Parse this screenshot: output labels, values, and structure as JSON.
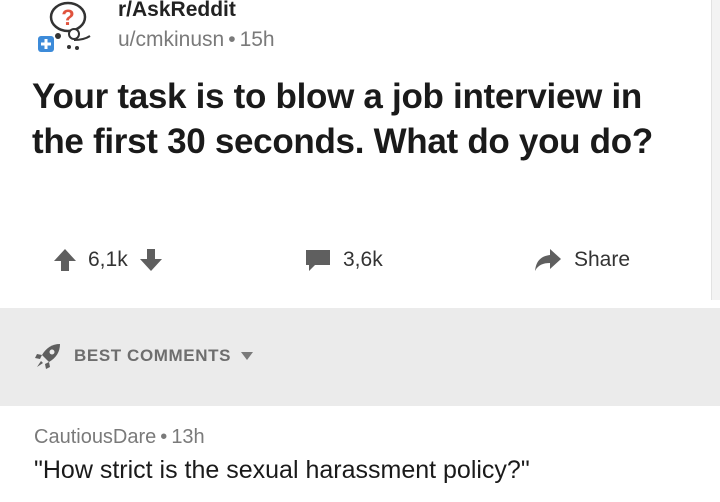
{
  "post": {
    "subreddit": "r/AskReddit",
    "author": "u/cmkinusn",
    "age": "15h",
    "title": "Your task is to blow a job interview in the first 30 seconds. What do you do?",
    "score": "6,1k",
    "comment_count": "3,6k",
    "share_label": "Share",
    "icons": {
      "subreddit": "askreddit-snoo-icon",
      "upvote": "arrow-up-icon",
      "downvote": "arrow-down-icon",
      "comments": "speech-bubble-icon",
      "share": "share-arrow-icon"
    }
  },
  "comments_header": {
    "sort_label": "BEST COMMENTS",
    "icons": {
      "sort": "rocket-icon",
      "dropdown": "chevron-down-icon"
    }
  },
  "comments": [
    {
      "author": "CautiousDare",
      "age": "13h",
      "body": "\"How strict is the sexual harassment policy?\""
    }
  ],
  "colors": {
    "page_bg": "#ffffff",
    "band_bg": "#ebebeb",
    "text": "#1a1a1a",
    "muted": "#7a7a7a",
    "icon": "#5f5f5f",
    "subreddit_badge": "#3d8bd9"
  }
}
